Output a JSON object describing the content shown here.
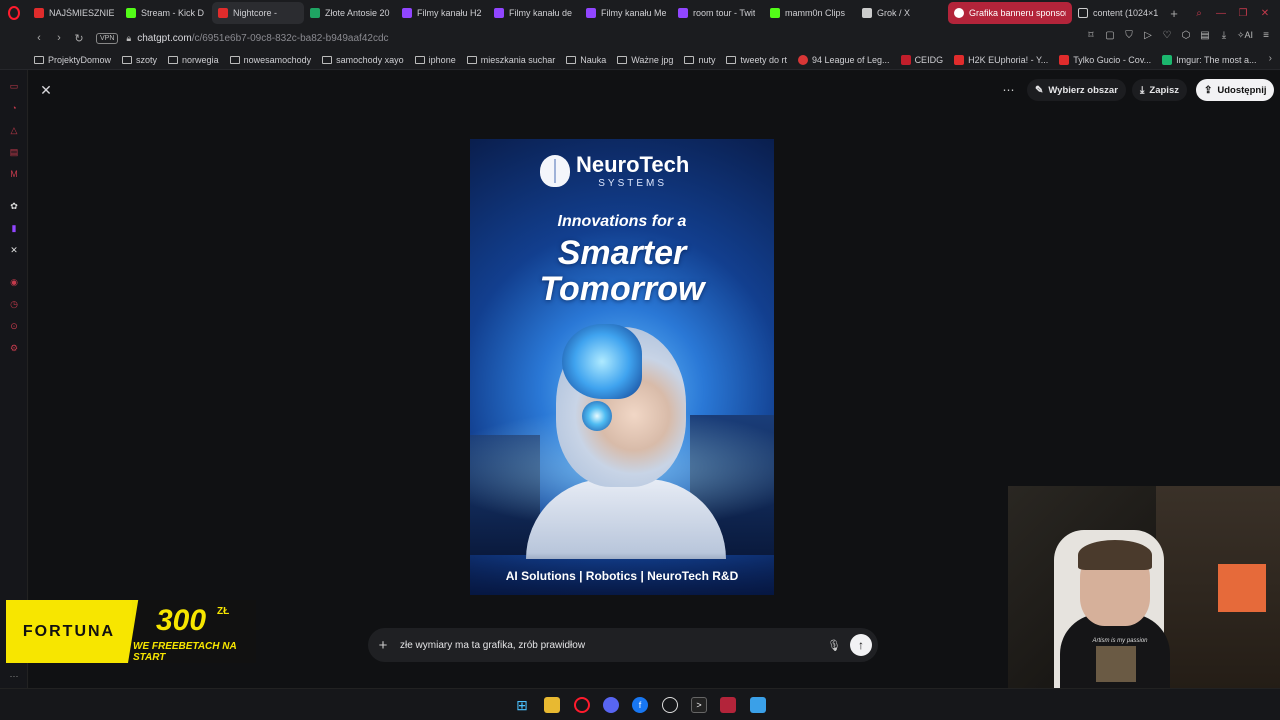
{
  "tabs": [
    {
      "label": "NAJŚMIESZNIEJ",
      "color": "#e02c2c"
    },
    {
      "label": "Stream - Kick D",
      "color": "#53fc18"
    },
    {
      "label": "Nightcore - ",
      "color": "#e02c2c"
    },
    {
      "label": "Złote Antosie 20",
      "color": "#1fa463"
    },
    {
      "label": "Filmy kanału H2",
      "color": "#9146ff"
    },
    {
      "label": "Filmy kanału de",
      "color": "#9146ff"
    },
    {
      "label": "Filmy kanału Me",
      "color": "#9146ff"
    },
    {
      "label": "room tour - Twit",
      "color": "#9146ff"
    },
    {
      "label": "mamm0n Clips",
      "color": "#53fc18"
    },
    {
      "label": "Grok / X",
      "color": "#cccccc"
    },
    {
      "label": "Grafika banneru sponsors",
      "color": "#ffffff"
    },
    {
      "label": "content (1024×1",
      "color": "#cccccc"
    }
  ],
  "address": {
    "vpn": "VPN",
    "url_host": "chatgpt.com",
    "url_path": "/c/6951e6b7-09c8-832c-ba82-b949aaf42cdc"
  },
  "bookmarks": [
    {
      "label": "ProjektyDomow",
      "kind": "folder"
    },
    {
      "label": "szoty",
      "kind": "folder"
    },
    {
      "label": "norwegia",
      "kind": "folder"
    },
    {
      "label": "nowesamochody",
      "kind": "folder"
    },
    {
      "label": "samochody xayo",
      "kind": "folder"
    },
    {
      "label": "iphone",
      "kind": "folder"
    },
    {
      "label": "mieszkania suchar",
      "kind": "folder"
    },
    {
      "label": "Nauka",
      "kind": "folder"
    },
    {
      "label": "Ważne jpg",
      "kind": "folder"
    },
    {
      "label": "nuty",
      "kind": "folder"
    },
    {
      "label": "tweety do rt",
      "kind": "folder"
    },
    {
      "label": "94 League of Leg...",
      "kind": "site"
    },
    {
      "label": "CEIDG",
      "kind": "site"
    },
    {
      "label": "H2K EUphoria! - Y...",
      "kind": "site"
    },
    {
      "label": "Tylko Gucio - Cov...",
      "kind": "site"
    },
    {
      "label": "Imgur: The most a...",
      "kind": "site"
    }
  ],
  "toolbar": {
    "select_area": "Wybierz obszar",
    "save": "Zapisz",
    "share": "Udostępnij"
  },
  "poster": {
    "brand_name": "NeuroTech",
    "brand_sub": "SYSTEMS",
    "tagline_1": "Innovations for a",
    "tagline_2": "Smarter",
    "tagline_3": "Tomorrow",
    "footer": "AI Solutions | Robotics | NeuroTech R&D"
  },
  "prompt": {
    "text": "złe wymiary ma ta grafika, zrób prawidłow"
  },
  "sponsor": {
    "brand": "FORTUNA",
    "amount": "300",
    "currency": "ZŁ",
    "line2": "WE FREEBETACH NA START"
  },
  "webcam": {
    "shirt_text": "Artism is my passion"
  },
  "colors": {
    "accent": "#b3243a",
    "opera_red": "#ff1b2d",
    "sponsor_yellow": "#f7e600"
  }
}
